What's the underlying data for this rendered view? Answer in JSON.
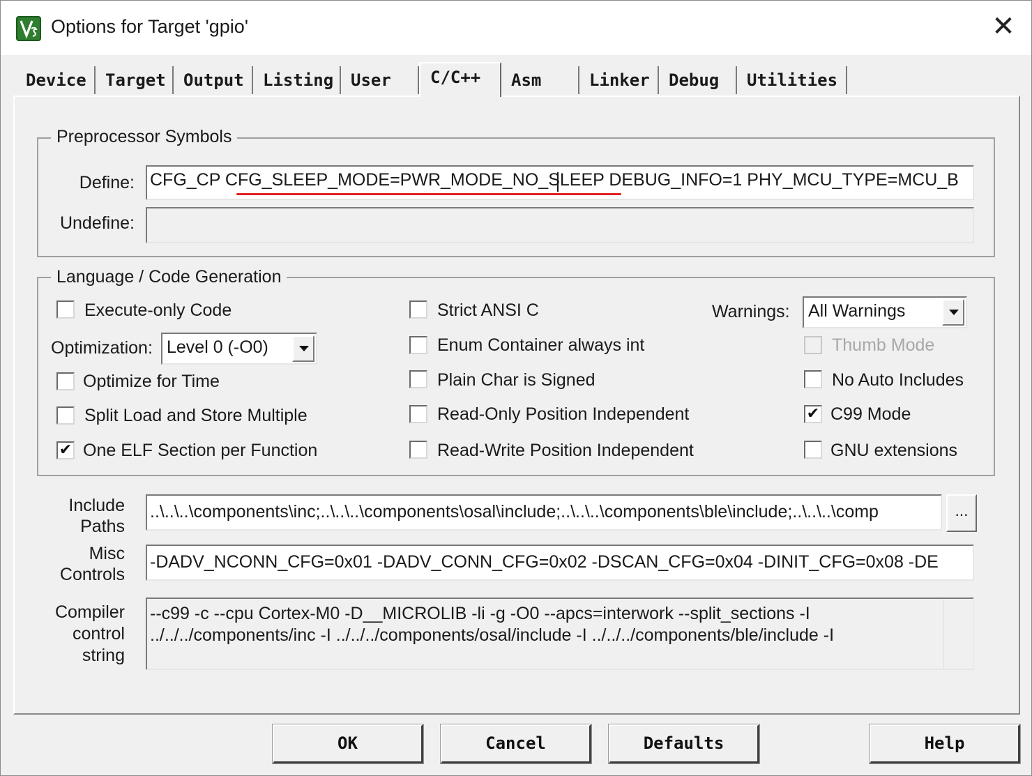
{
  "window": {
    "title": "Options for Target 'gpio'",
    "close_glyph": "✕",
    "app_icon": "keil-uvision-icon"
  },
  "tabs": [
    {
      "label": "Device"
    },
    {
      "label": "Target"
    },
    {
      "label": "Output"
    },
    {
      "label": "Listing"
    },
    {
      "label": "User"
    },
    {
      "label": "C/C++",
      "active": true
    },
    {
      "label": "Asm"
    },
    {
      "label": "Linker"
    },
    {
      "label": "Debug"
    },
    {
      "label": "Utilities"
    }
  ],
  "preprocessor": {
    "group_title": "Preprocessor Symbols",
    "define_label": "Define:",
    "define_value": "CFG_CP   CFG_SLEEP_MODE=PWR_MODE_NO_SLEEP DEBUG_INFO=1 PHY_MCU_TYPE=MCU_B",
    "undefine_label": "Undefine:",
    "undefine_value": "",
    "annotation_color": "#e02020"
  },
  "language": {
    "group_title": "Language / Code Generation",
    "execute_only": {
      "label": "Execute-only Code",
      "checked": false
    },
    "optimization_label": "Optimization:",
    "optimization_value": "Level 0 (-O0)",
    "optimize_time": {
      "label": "Optimize for Time",
      "checked": false
    },
    "split_load": {
      "label": "Split Load and Store Multiple",
      "checked": false
    },
    "one_elf": {
      "label": "One ELF Section per Function",
      "checked": true
    },
    "strict_ansi": {
      "label": "Strict ANSI C",
      "checked": false
    },
    "enum_container": {
      "label": "Enum Container always int",
      "checked": false
    },
    "plain_char": {
      "label": "Plain Char is Signed",
      "checked": false
    },
    "ropi": {
      "label": "Read-Only Position Independent",
      "checked": false
    },
    "rwpi": {
      "label": "Read-Write Position Independent",
      "checked": false
    },
    "warnings_label": "Warnings:",
    "warnings_value": "All Warnings",
    "thumb_mode": {
      "label": "Thumb Mode",
      "checked": false,
      "disabled": true
    },
    "no_auto_includes": {
      "label": "No Auto Includes",
      "checked": false
    },
    "c99_mode": {
      "label": "C99 Mode",
      "checked": true
    },
    "gnu_extensions": {
      "label": "GNU extensions",
      "checked": false
    },
    "check_glyph": "✔"
  },
  "paths": {
    "include_label_1": "Include",
    "include_label_2": "Paths",
    "include_value": "..\\..\\..\\components\\inc;..\\..\\..\\components\\osal\\include;..\\..\\..\\components\\ble\\include;..\\..\\..\\comp",
    "browse_label": "...",
    "misc_label_1": "Misc",
    "misc_label_2": "Controls",
    "misc_value": "-DADV_NCONN_CFG=0x01   -DADV_CONN_CFG=0x02   -DSCAN_CFG=0x04   -DINIT_CFG=0x08   -DE",
    "compiler_label_1": "Compiler",
    "compiler_label_2": "control",
    "compiler_label_3": "string",
    "compiler_value": "--c99 -c --cpu Cortex-M0 -D__MICROLIB -li -g -O0 --apcs=interwork --split_sections -I ../../../components/inc -I ../../../components/osal/include -I ../../../components/ble/include -I"
  },
  "buttons": {
    "ok": "OK",
    "cancel": "Cancel",
    "defaults": "Defaults",
    "help": "Help"
  }
}
